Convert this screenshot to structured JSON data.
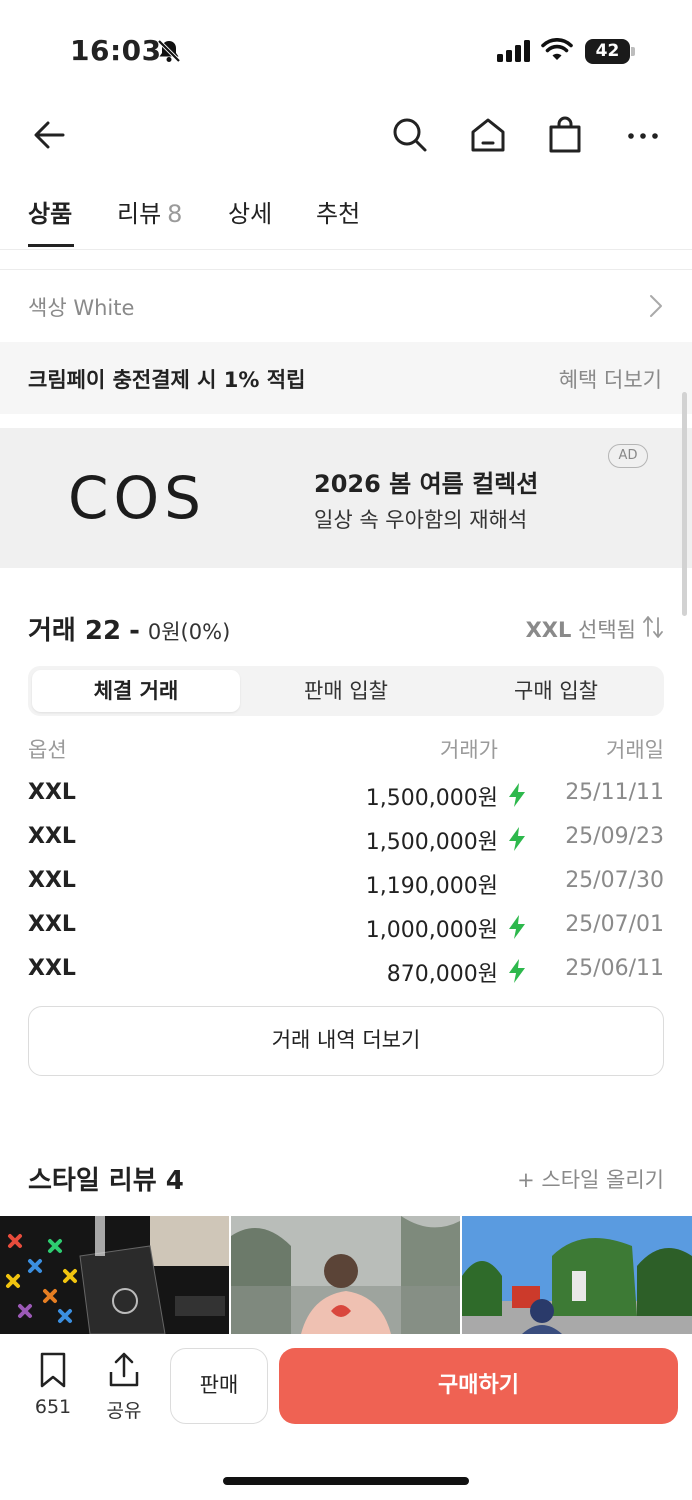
{
  "status_bar": {
    "time": "16:03",
    "battery": "42"
  },
  "nav": {
    "icons": [
      "back-arrow-icon",
      "search-icon",
      "home-icon",
      "shopping-bag-icon",
      "more-icon"
    ]
  },
  "tabs": [
    {
      "label": "상품",
      "count": ""
    },
    {
      "label": "리뷰",
      "count": "8"
    },
    {
      "label": "상세",
      "count": ""
    },
    {
      "label": "추천",
      "count": ""
    }
  ],
  "color_option": {
    "text": "색상 White"
  },
  "benefit": {
    "text": "크림페이 충전결제 시 1% 적립",
    "more": "혜택 더보기"
  },
  "ad": {
    "logo": "COS",
    "title": "2026 봄 여름 컬렉션",
    "subtitle": "일상 속 우아함의 재해석",
    "badge": "AD"
  },
  "trades": {
    "title": "거래 22",
    "dash": "-",
    "amount": "0원(0%)",
    "selected_size": "XXL",
    "selected_suffix": "선택됨",
    "segments": [
      "체결 거래",
      "판매 입찰",
      "구매 입찰"
    ],
    "columns": [
      "옵션",
      "거래가",
      "거래일"
    ],
    "rows": [
      {
        "option": "XXL",
        "price": "1,500,000원",
        "fast": true,
        "date": "25/11/11"
      },
      {
        "option": "XXL",
        "price": "1,500,000원",
        "fast": true,
        "date": "25/09/23"
      },
      {
        "option": "XXL",
        "price": "1,190,000원",
        "fast": false,
        "date": "25/07/30"
      },
      {
        "option": "XXL",
        "price": "1,000,000원",
        "fast": true,
        "date": "25/07/01"
      },
      {
        "option": "XXL",
        "price": "870,000원",
        "fast": true,
        "date": "25/06/11"
      }
    ],
    "more_button": "거래 내역 더보기"
  },
  "style_reviews": {
    "title": "스타일 리뷰 4",
    "upload": "+ 스타일 올리기"
  },
  "bottom_bar": {
    "bookmark_count": "651",
    "share_label": "공유",
    "sell_label": "판매",
    "buy_label": "구매하기"
  },
  "colors": {
    "accent": "#EF6253",
    "fast_bolt": "#2DB84C",
    "text_primary": "#222222",
    "text_secondary": "#8A8A8A"
  }
}
